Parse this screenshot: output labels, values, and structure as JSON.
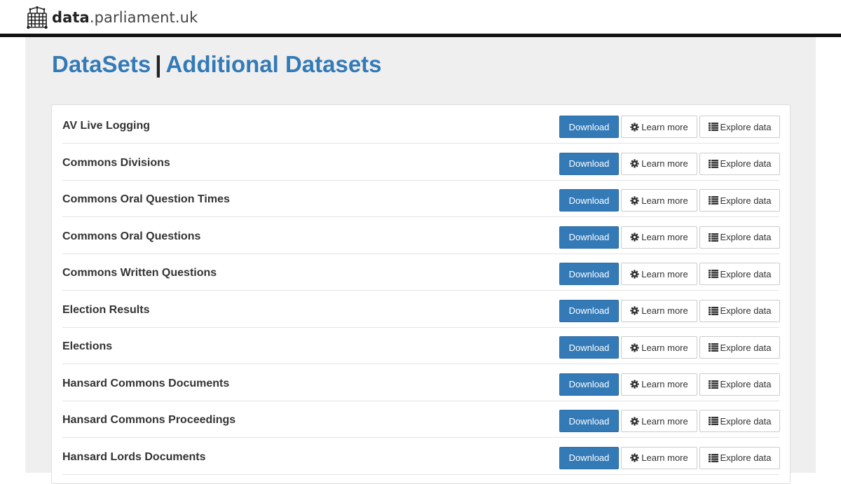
{
  "site": {
    "brand_bold": "data",
    "brand_rest": ".parliament.uk",
    "logo_icon": "portcullis-icon"
  },
  "header": {
    "title_part1": "DataSets",
    "separator": "|",
    "title_part2": "Additional Datasets"
  },
  "colors": {
    "accent": "#337ab7",
    "panel_bg": "#efefef",
    "topbar_rule": "#111111"
  },
  "actions": {
    "download_label": "Download",
    "learn_label": "Learn more",
    "learn_icon": "gear-icon",
    "explore_label": "Explore data",
    "explore_icon": "list-icon"
  },
  "datasets": [
    {
      "name": "AV Live Logging"
    },
    {
      "name": "Commons Divisions"
    },
    {
      "name": "Commons Oral Question Times"
    },
    {
      "name": "Commons Oral Questions"
    },
    {
      "name": "Commons Written Questions"
    },
    {
      "name": "Election Results"
    },
    {
      "name": "Elections"
    },
    {
      "name": "Hansard Commons Documents"
    },
    {
      "name": "Hansard Commons Proceedings"
    },
    {
      "name": "Hansard Lords Documents"
    }
  ]
}
